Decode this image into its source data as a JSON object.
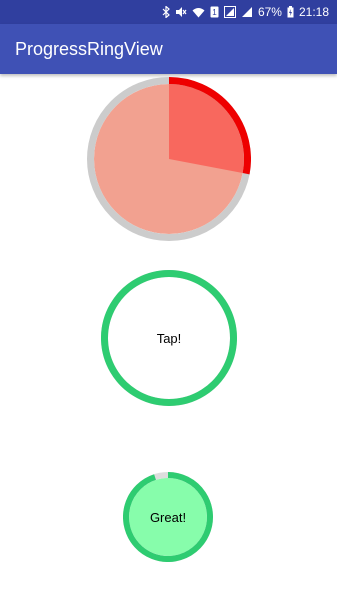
{
  "status_bar": {
    "battery_percent": "67%",
    "time": "21:18",
    "icons": [
      "bluetooth-icon",
      "mute-icon",
      "wifi-icon",
      "sim-1-icon",
      "signal-icon",
      "signal-icon",
      "battery-charging-icon"
    ]
  },
  "app_bar": {
    "title": "ProgressRingView",
    "color": "#3f51b5",
    "status_color": "#303f9f"
  },
  "rings": [
    {
      "id": "ring-pie",
      "progress": 0.28,
      "label": "",
      "ring_color": "#ee0000",
      "track_color": "#cccccc",
      "fill_color": "#f2a190",
      "progress_fill_color": "#f8685e"
    },
    {
      "id": "ring-tap",
      "progress": 1.0,
      "label": "Tap!",
      "ring_color": "#2ecc71",
      "track_color": "#cccccc",
      "fill_color": "#ffffff"
    },
    {
      "id": "ring-great",
      "progress": 0.95,
      "label": "Great!",
      "ring_color": "#2ecc71",
      "track_color": "#dddddd",
      "fill_color": "#87fdab"
    }
  ]
}
